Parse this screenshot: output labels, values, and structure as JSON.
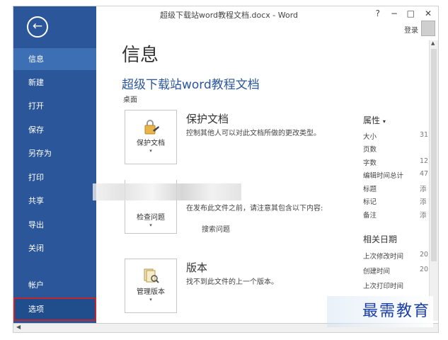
{
  "window": {
    "title": "超级下载站word教程文档.docx - Word",
    "help": "?",
    "minimize": "−",
    "restore": "□",
    "close": "✕",
    "login": "登录"
  },
  "sidebar": {
    "back_icon": "←",
    "items": [
      {
        "label": "信息"
      },
      {
        "label": "新建"
      },
      {
        "label": "打开"
      },
      {
        "label": "保存"
      },
      {
        "label": "另存为"
      },
      {
        "label": "打印"
      },
      {
        "label": "共享"
      },
      {
        "label": "导出"
      },
      {
        "label": "关闭"
      },
      {
        "label": "帐户"
      },
      {
        "label": "选项"
      }
    ],
    "active": "信息",
    "highlighted": "选项",
    "colors": {
      "panel": "#2b579a",
      "active": "#3d6fb5",
      "highlight_border": "#c0262d"
    }
  },
  "main": {
    "heading": "信息",
    "doc_name": "超级下载站word教程文档",
    "location": "桌面",
    "sections": [
      {
        "tile_label": "保护文档",
        "title": "保护文档",
        "desc": "控制其他人可以对此文档所做的更改类型。"
      },
      {
        "tile_label": "检查问题",
        "title": "",
        "desc": "在发布此文件之前，请注意其包含以下内容:",
        "item": "搜索问题"
      },
      {
        "tile_label": "管理版本",
        "title": "版本",
        "desc": "找不到此文件的上一个版本。"
      }
    ]
  },
  "properties": {
    "heading": "属性",
    "rows": [
      {
        "label": "大小",
        "value": "31"
      },
      {
        "label": "页数",
        "value": ""
      },
      {
        "label": "字数",
        "value": "12"
      },
      {
        "label": "编辑时间总计",
        "value": "47"
      },
      {
        "label": "标题",
        "value": "添"
      },
      {
        "label": "标记",
        "value": "添"
      },
      {
        "label": "备注",
        "value": "添"
      }
    ],
    "dates_heading": "相关日期",
    "dates": [
      {
        "label": "上次修改时间",
        "value": "20"
      },
      {
        "label": "创建时间",
        "value": "20"
      },
      {
        "label": "上次打印时间",
        "value": ""
      }
    ]
  },
  "watermark": "最需教育"
}
